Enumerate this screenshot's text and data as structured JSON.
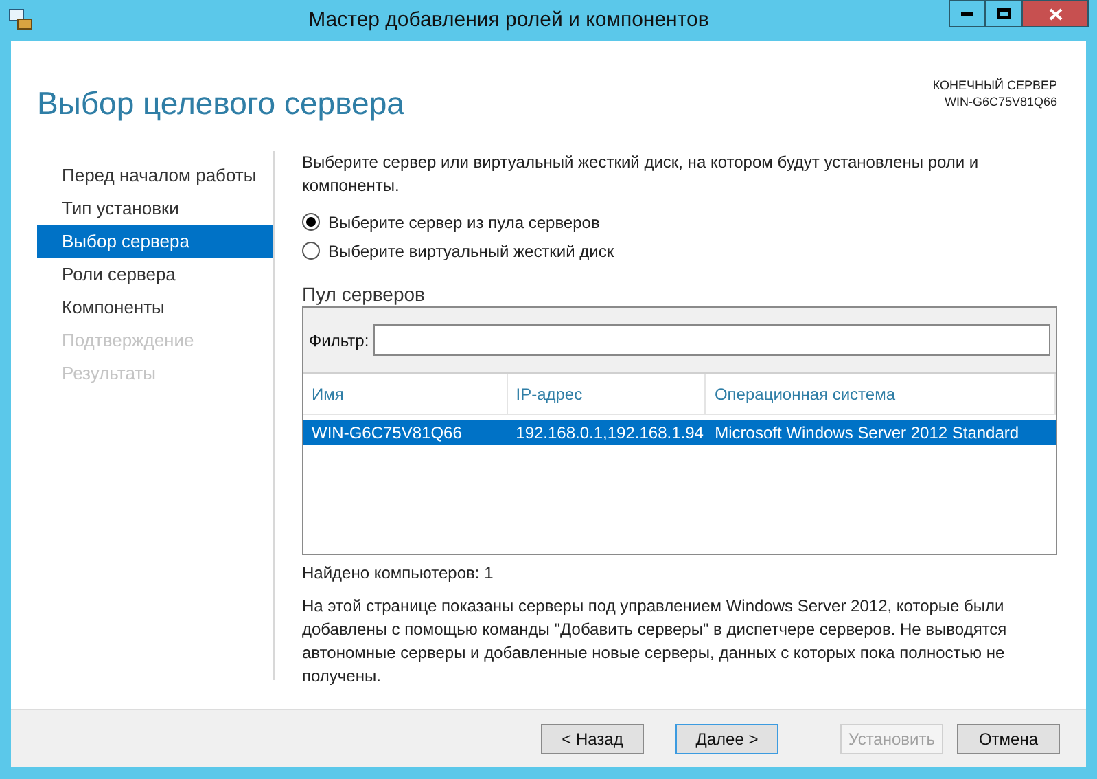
{
  "window": {
    "title": "Мастер добавления ролей и компонентов"
  },
  "header": {
    "title": "Выбор целевого сервера",
    "destination_label": "КОНЕЧНЫЙ СЕРВЕР",
    "destination_server": "WIN-G6C75V81Q66"
  },
  "sidebar": {
    "items": [
      {
        "label": "Перед началом работы",
        "selected": false,
        "disabled": false
      },
      {
        "label": "Тип установки",
        "selected": false,
        "disabled": false
      },
      {
        "label": "Выбор сервера",
        "selected": true,
        "disabled": false
      },
      {
        "label": "Роли сервера",
        "selected": false,
        "disabled": false
      },
      {
        "label": "Компоненты",
        "selected": false,
        "disabled": false
      },
      {
        "label": "Подтверждение",
        "selected": false,
        "disabled": true
      },
      {
        "label": "Результаты",
        "selected": false,
        "disabled": true
      }
    ]
  },
  "description": "Выберите сервер или виртуальный жесткий диск, на котором будут установлены роли и компоненты.",
  "options": [
    {
      "label": "Выберите сервер из пула серверов",
      "selected": true
    },
    {
      "label": "Выберите виртуальный жесткий диск",
      "selected": false
    }
  ],
  "pool": {
    "title": "Пул серверов",
    "filter_label": "Фильтр:"
  },
  "table": {
    "columns": [
      "Имя",
      "IP-адрес",
      "Операционная система"
    ],
    "rows": [
      {
        "cells": [
          "WIN-G6C75V81Q66",
          "192.168.0.1,192.168.1.94",
          "Microsoft Windows Server 2012 Standard"
        ],
        "selected": true
      }
    ]
  },
  "found_count": "Найдено компьютеров: 1",
  "info": "На этой странице показаны серверы под управлением Windows Server 2012, которые были добавлены с помощью команды \"Добавить серверы\" в диспетчере серверов. Не выводятся автономные серверы и добавленные новые серверы, данных с которых пока полностью не получены.",
  "buttons": [
    {
      "label": "< Назад",
      "disabled": false,
      "default": false
    },
    {
      "label": "Далее >",
      "disabled": false,
      "default": true
    },
    {
      "label": "Установить",
      "disabled": true,
      "default": false
    },
    {
      "label": "Отмена",
      "disabled": false,
      "default": false
    }
  ]
}
